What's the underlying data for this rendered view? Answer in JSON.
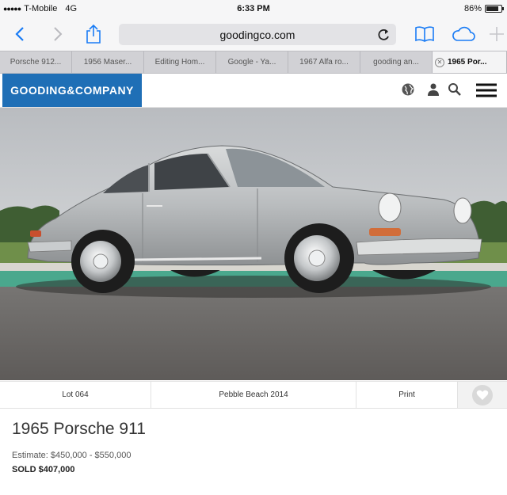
{
  "status_bar": {
    "signal": "●●●●●",
    "carrier": "T-Mobile",
    "network": "4G",
    "time": "6:33 PM",
    "battery": "86%"
  },
  "browser": {
    "url": "goodingco.com",
    "icons": [
      "back-icon",
      "forward-icon",
      "share-icon",
      "reload-icon",
      "bookmarks-icon",
      "cloud-tabs-icon",
      "new-tab-icon"
    ]
  },
  "tabs": [
    {
      "label": "Porsche 912..."
    },
    {
      "label": "1956 Maser..."
    },
    {
      "label": "Editing Hom..."
    },
    {
      "label": "Google - Ya..."
    },
    {
      "label": "1967 Alfa ro..."
    },
    {
      "label": "gooding an..."
    },
    {
      "label": "1965 Por...",
      "active": true
    }
  ],
  "site": {
    "logo": "GOODING&COMPANY",
    "logo_color": "#1f6fb6",
    "icons": [
      "globe-icon",
      "user-icon",
      "search-icon",
      "menu-icon"
    ]
  },
  "lot": {
    "lot_number": "Lot 064",
    "auction": "Pebble Beach 2014",
    "print_label": "Print",
    "title": "1965 Porsche 911",
    "estimate": "Estimate: $450,000 - $550,000",
    "sold": "SOLD $407,000"
  }
}
